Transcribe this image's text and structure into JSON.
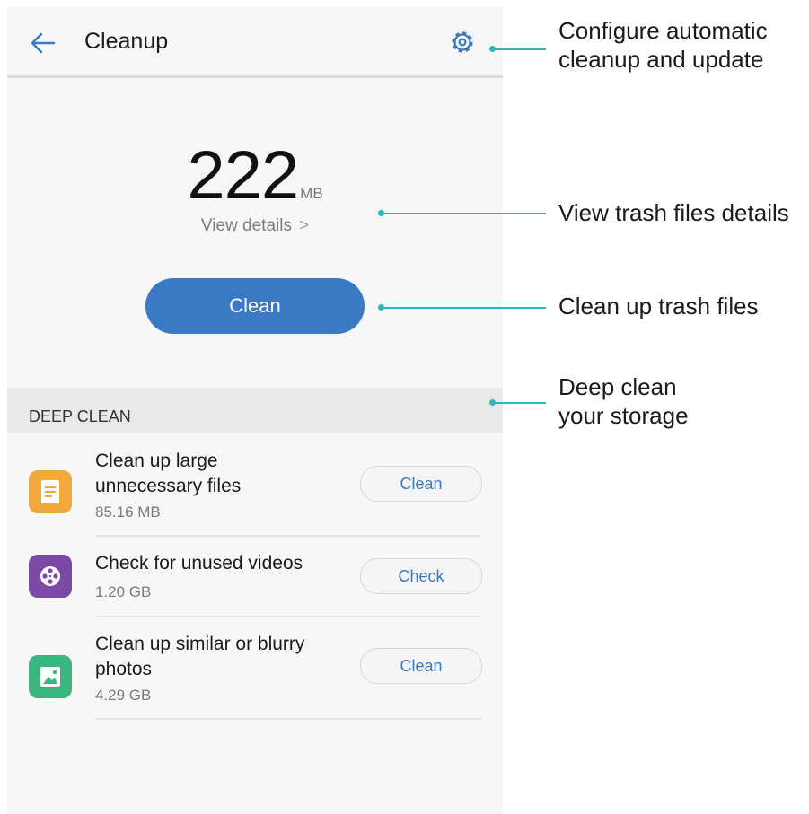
{
  "header": {
    "title": "Cleanup",
    "back_icon": "back-arrow-icon",
    "settings_icon": "gear-icon"
  },
  "summary": {
    "size_value": "222",
    "size_unit": "MB",
    "view_details": "View details",
    "chevron": ">"
  },
  "clean_button": {
    "label": "Clean"
  },
  "deep_clean": {
    "section_title": "DEEP CLEAN",
    "items": [
      {
        "title_line1": "Clean up large",
        "title_line2": "unnecessary files",
        "size": "85.16 MB",
        "action": "Clean",
        "icon": "document-icon",
        "icon_color": "#f2a93b"
      },
      {
        "title_line1": "Check for unused videos",
        "size": "1.20 GB",
        "action": "Check",
        "icon": "film-reel-icon",
        "icon_color": "#7b4aa6"
      },
      {
        "title_line1": "Clean up similar or blurry",
        "title_line2": "photos",
        "size": "4.29 GB",
        "action": "Clean",
        "icon": "photo-icon",
        "icon_color": "#3ab67e"
      }
    ]
  },
  "callouts": {
    "settings": {
      "line1": "Configure automatic",
      "line2": "cleanup and update"
    },
    "details": {
      "text": "View trash files details"
    },
    "clean": {
      "text": "Clean up trash files"
    },
    "deep": {
      "line1": "Deep clean",
      "line2": "your storage"
    }
  },
  "colors": {
    "accent": "#3a79c4",
    "callout": "#2fb6bd",
    "background": "#f7f7f7"
  }
}
